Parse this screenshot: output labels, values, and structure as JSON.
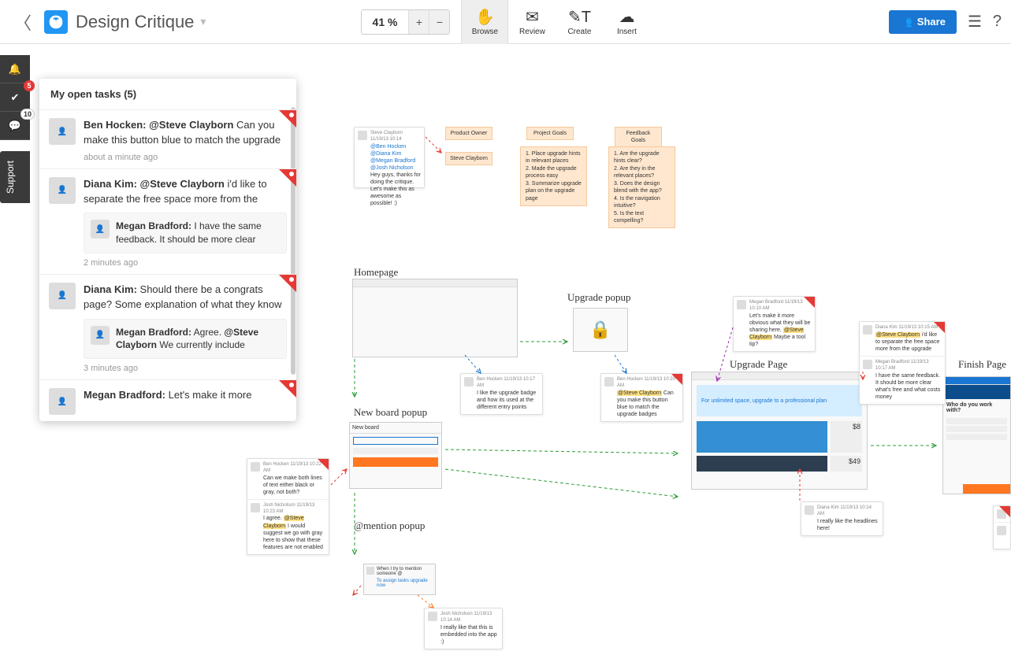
{
  "header": {
    "board_title": "Design Critique",
    "zoom": "41 %",
    "modes": {
      "browse": "Browse",
      "review": "Review",
      "create": "Create",
      "insert": "Insert"
    },
    "share": "Share"
  },
  "rail": {
    "notif_badge": "5",
    "comment_badge": "10",
    "support": "Support"
  },
  "tasks": {
    "title": "My open tasks (5)",
    "items": [
      {
        "author": "Ben Hocken:",
        "mention": "@Steve Clayborn",
        "text": " Can you make this button blue to match the upgrade",
        "time": "about a minute ago"
      },
      {
        "author": "Diana Kim:",
        "mention": "@Steve Clayborn",
        "text": " i'd like to separate the free space more from the",
        "reply": {
          "author": "Megan Bradford:",
          "text": " I have the same feedback. It should be more clear"
        },
        "time": "2 minutes ago"
      },
      {
        "author": "Diana Kim:",
        "mention": "",
        "text": "Should there be a congrats page? Some explanation of what they know",
        "reply": {
          "author": "Megan Bradford:",
          "text_pre": " Agree. ",
          "mention": "@Steve Clayborn",
          "text_post": " We currently include"
        },
        "time": "3 minutes ago"
      },
      {
        "author": "Megan Bradford:",
        "mention": "",
        "text": "Let's make it more"
      }
    ]
  },
  "canvas": {
    "labels": {
      "homepage": "Homepage",
      "new_board": "New board popup",
      "mention": "@mention popup",
      "upgrade_popup": "Upgrade popup",
      "upgrade_page": "Upgrade Page",
      "finish_page": "Finish Page"
    },
    "stickies": {
      "product_owner": "Product Owner",
      "owner_name": "Steve Clayborn",
      "project_goals": "Project Goals",
      "goals_body": "1. Place upgrade hints in relevant places\n2. Made the upgrade process easy\n3. Summarize upgrade plan on the upgrade page",
      "feedback_goals": "Feedback Goals",
      "feedback_body": "1. Are the upgrade hints clear?\n2. Are they in the relevant places?\n3. Does the design blend with the app?\n4. Is the navigation intuitive?\n5. Is the text compelling?"
    },
    "notes": {
      "intro": {
        "header": "Steve Clayborn 11/19/13 10:14",
        "body_links": "@Ben Hocken @Diana Kim @Megan Bradford @Josh Nicholson",
        "body_text": " Hey guys, thanks for doing the critique. Let's make this as awesome as possible! :)"
      },
      "homepage_note": {
        "header": "Ben Hocken 11/19/13 10:17 AM",
        "text": "I like the upgrade badge and how its used at the different entry points"
      },
      "popup_note": {
        "header": "Ben Hocken 11/19/13 10:20 AM",
        "mention": "@Steve Clayborn",
        "text": " Can you make this button blue to match the upgrade badges"
      },
      "newboard_note": {
        "h1": "Ben Hocken 11/19/13 10:22 AM",
        "t1": "Can we make both lines of text either black or gray, not both?",
        "h2": "Josh Nicholson 11/19/13 10:23 AM",
        "t2_pre": "I agree. ",
        "t2_mention": "@Steve Clayborn",
        "t2_post": " I would suggest we go with gray here to show that these features are not enabled"
      },
      "upgrade_note1": {
        "header": "Megan Bradford 11/19/13 10:10 AM",
        "text": "Let's make it more obvious what they will be sharing here. ",
        "mention": "@Steve Clayborn",
        "text2": " Maybe a tool tip?"
      },
      "upgrade_note2": {
        "h1": "Diana Kim 11/19/13 10:15 AM",
        "t1_mention": "@Steve Clayborn",
        "t1": " i'd like to separate the free space more from the upgrade",
        "h2": "Megan Bradford 11/19/13 10:17 AM",
        "t2": "I have the same feedback. It should be more clear what's free and what costs money"
      },
      "headline_note": {
        "header": "Diana Kim 11/19/13 10:14 AM",
        "text": "I really like the headlines here!"
      },
      "mention_note": {
        "header": "Josh Nicholson 11/19/13 10:14 AM",
        "text": "I really like that this is embedded into the app :)"
      },
      "mention_popup": {
        "t1": "When I try to mention someone @",
        "t2": "To assign tasks upgrade now"
      },
      "finish_text": "Who do you work with?"
    }
  }
}
